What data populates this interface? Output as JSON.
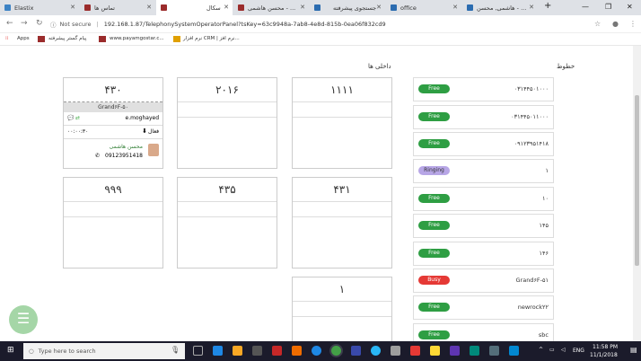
{
  "tabs": [
    {
      "label": "Elastix",
      "active": false,
      "fav": "#3b82c4"
    },
    {
      "label": "تماس ها",
      "active": false,
      "fav": "#9b2c2c"
    },
    {
      "label": "سکال",
      "active": true,
      "fav": "#9b2c2c"
    },
    {
      "label": "محسن هاشمی - ...",
      "active": false,
      "fav": "#9b2c2c"
    },
    {
      "label": "جستجوی پیشرفته",
      "active": false,
      "fav": "#2b6cb0"
    },
    {
      "label": "office",
      "active": false,
      "fav": "#2b6cb0"
    },
    {
      "label": "هاشمی, محسن - ...",
      "active": false,
      "fav": "#2b6cb0"
    }
  ],
  "window": {
    "minimize": "—",
    "restore": "❐",
    "close": "✕",
    "new_tab": "+"
  },
  "address": {
    "security": "Not secure",
    "url": "192.168.1.87/TelephonySystemOperatorPanel?tsKey=63c9948a-7ab8-4e8d-815b-0ea06f832cd9"
  },
  "bookmarks": {
    "apps": "Apps",
    "b1": "پیام گستر پیشرفته",
    "b2": "www.payamgostar.c...",
    "b3": "نرم افزار CRM | نرم افز..."
  },
  "headings": {
    "lines": "خطوط",
    "extensions": "داخلی ها"
  },
  "lines": [
    {
      "status": "Free",
      "number": "۰۳۱۴۴۵۰۱۰۰۰",
      "color": "#2e9e43"
    },
    {
      "status": "Free",
      "number": "۰۳۱۴۴۵۰۱۱۰۰۰",
      "color": "#2e9e43"
    },
    {
      "status": "Free",
      "number": "۰۹۱۲۳۹۵۱۴۱۸",
      "color": "#2e9e43"
    },
    {
      "status": "Ringing",
      "number": "۱",
      "color": "#b7a6e6"
    },
    {
      "status": "Free",
      "number": "۱۰",
      "color": "#2e9e43"
    },
    {
      "status": "Free",
      "number": "۱۴۵",
      "color": "#2e9e43"
    },
    {
      "status": "Free",
      "number": "۱۴۶",
      "color": "#2e9e43"
    },
    {
      "status": "Busy",
      "number": "Grand۶F-۵۱",
      "color": "#e53935"
    },
    {
      "status": "Free",
      "number": "newrock۲۲",
      "color": "#2e9e43"
    },
    {
      "status": "Free",
      "number": "sbc",
      "color": "#2e9e43"
    }
  ],
  "extensions": [
    {
      "number": "۱۱۱۱"
    },
    {
      "number": "۲۰۱۶"
    },
    {
      "number": "۴۳۰",
      "device": "Grand۶F-۵۰",
      "user": "e.moghayed",
      "state": "فعال",
      "timer": "۰۰:۰۰:۳۰",
      "contact_name": "محسن هاشمی",
      "contact_phone": "09123951418"
    },
    {
      "number": "۴۳۱"
    },
    {
      "number": "۴۳۵"
    },
    {
      "number": "۹۹۹"
    },
    {
      "number": "۱"
    }
  ],
  "fab": "☰",
  "taskbar": {
    "search": "Type here to search",
    "lang": "ENG",
    "time": "11:58 PM",
    "date": "11/1/2018"
  }
}
